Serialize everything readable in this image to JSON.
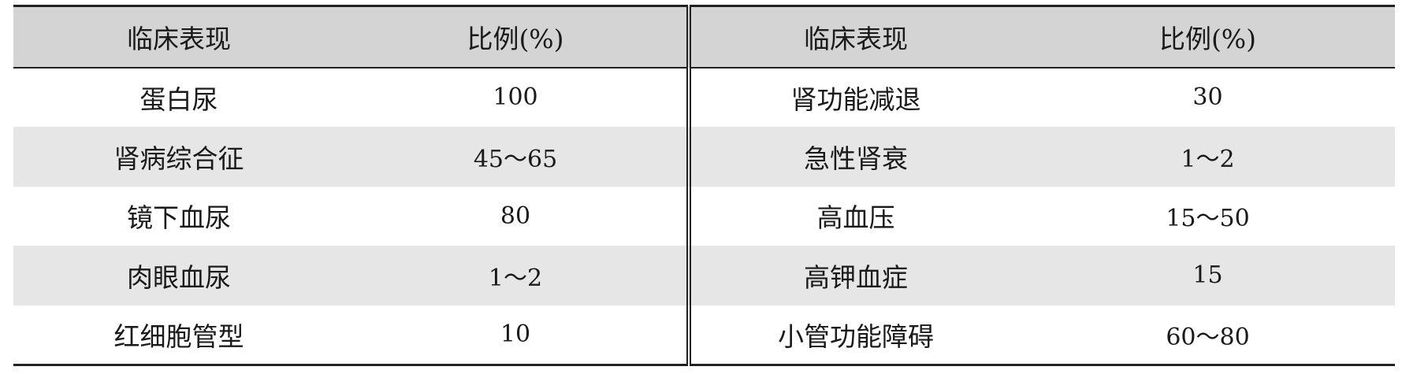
{
  "table": {
    "headers": [
      "临床表现",
      "比例(%)",
      "临床表现",
      "比例(%)"
    ],
    "rows": [
      [
        "蛋白尿",
        "100",
        "肾功能减退",
        "30"
      ],
      [
        "肾病综合征",
        "45～65",
        "急性肾衰",
        "1～2"
      ],
      [
        "镜下血尿",
        "80",
        "高血压",
        "15～50"
      ],
      [
        "肉眼血尿",
        "1～2",
        "高钾血症",
        "15"
      ],
      [
        "红细胞管型",
        "10",
        "小管功能障碍",
        "60～80"
      ]
    ]
  }
}
